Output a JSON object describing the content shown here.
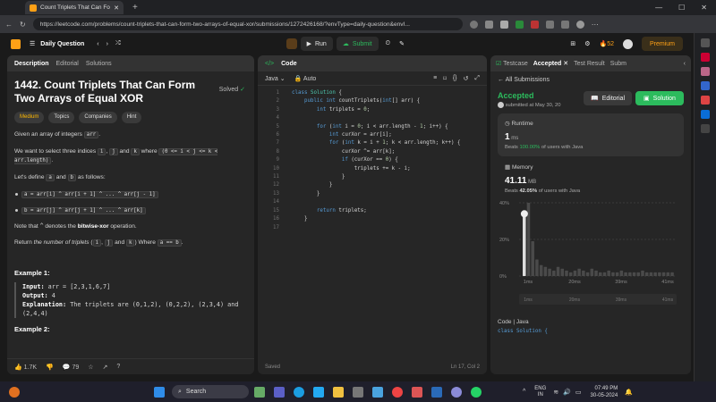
{
  "browser": {
    "tab_title": "Count Triplets That Can Form Tw…",
    "url": "https://leetcode.com/problems/count-triplets-that-can-form-two-arrays-of-equal-xor/submissions/1272426168/?envType=daily-question&envI..."
  },
  "header": {
    "daily": "Daily Question",
    "run": "Run",
    "submit": "Submit",
    "streak": "52",
    "premium": "Premium"
  },
  "desc_tabs": [
    "Description",
    "Editorial",
    "Solutions"
  ],
  "problem": {
    "title": "1442. Count Triplets That Can Form Two Arrays of Equal XOR",
    "solved": "Solved",
    "difficulty": "Medium",
    "chips": [
      "Topics",
      "Companies",
      "Hint"
    ],
    "p1a": "Given an array of integers ",
    "arr": "arr",
    "p1b": ".",
    "p2a": "We want to select three indices ",
    "i": "i",
    "j": "j",
    "k": "k",
    "p2b": " and ",
    "p2c": " where ",
    "cond": "(0 <= i < j <= k < arr.length)",
    "p2d": ".",
    "p3a": "Let's define ",
    "a": "a",
    "and": " and ",
    "b": "b",
    "p3b": " as follows:",
    "b1": "a = arr[i] ^ arr[i + 1] ^ ... ^ arr[j - 1]",
    "b2": "b = arr[j] ^ arr[j + 1] ^ ... ^ arr[k]",
    "p4a": "Note that ",
    "caret": "^",
    "p4b": " denotes the ",
    "xor": "bitwise-xor",
    "p4c": " operation.",
    "p5a": "Return ",
    "p5b": "the number of triplets",
    "p5c": " (",
    "p5d": ",",
    "p5e": " and ",
    "p5f": ") Where ",
    "p5g": "a == b",
    "p5h": ".",
    "ex1": "Example 1:",
    "in_l": "Input:",
    "in_v": " arr = [2,3,1,6,7]",
    "out_l": "Output:",
    "out_v": " 4",
    "exp_l": "Explanation:",
    "exp_v": " The triplets are (0,1,2), (0,2,2), (2,3,4) and (2,4,4)",
    "ex2": "Example 2:"
  },
  "desc_footer": {
    "likes": "1.7K",
    "comments": "79"
  },
  "code_panel": {
    "title": "Code",
    "lang": "Java",
    "auto": "Auto",
    "saved": "Saved",
    "pos": "Ln 17, Col 2",
    "line_nums": [
      "1",
      "2",
      "3",
      "4",
      "5",
      "6",
      "7",
      "8",
      "9",
      "10",
      "11",
      "12",
      "13",
      "14",
      "15",
      "16",
      "17"
    ]
  },
  "result_tabs": [
    "Testcase",
    "Accepted",
    "Test Result",
    "Subm"
  ],
  "result": {
    "all": "All Submissions",
    "status": "Accepted",
    "submitted": "submitted at May 30, 20",
    "editorial": "Editorial",
    "solution": "Solution",
    "runtime_label": "Runtime",
    "runtime_val": "1",
    "runtime_unit": " ms",
    "beats": "Beats ",
    "rt_pct": "100.00%",
    "rt_tail": " of users with Java",
    "mem_label": "Memory",
    "mem_val": "41.11",
    "mem_unit": " MB",
    "mem_pct": "42.05%",
    "mem_tail": " of users with Java",
    "code_label": "Code",
    "code_lang": "Java",
    "code_peek": "class Solution {"
  },
  "chart_data": {
    "type": "bar",
    "ylabels": [
      "40%",
      "20%",
      "0%"
    ],
    "xlabels": [
      "1ms",
      "20ms",
      "39ms",
      "41ms"
    ],
    "values": [
      34,
      40,
      19,
      9,
      6,
      5,
      4,
      3,
      5,
      4,
      3,
      2,
      3,
      4,
      3,
      2,
      4,
      3,
      2,
      2,
      3,
      2,
      2,
      3,
      2,
      2,
      2,
      2,
      3,
      2,
      2,
      2,
      2,
      2,
      2,
      2
    ],
    "ylim": [
      0,
      40
    ]
  },
  "taskbar": {
    "search": "Search",
    "lang1": "ENG",
    "lang2": "IN",
    "time": "07:49 PM",
    "date": "30-05-2024"
  },
  "colors": {
    "accent": "#ffa116",
    "green": "#2cbb5d"
  }
}
